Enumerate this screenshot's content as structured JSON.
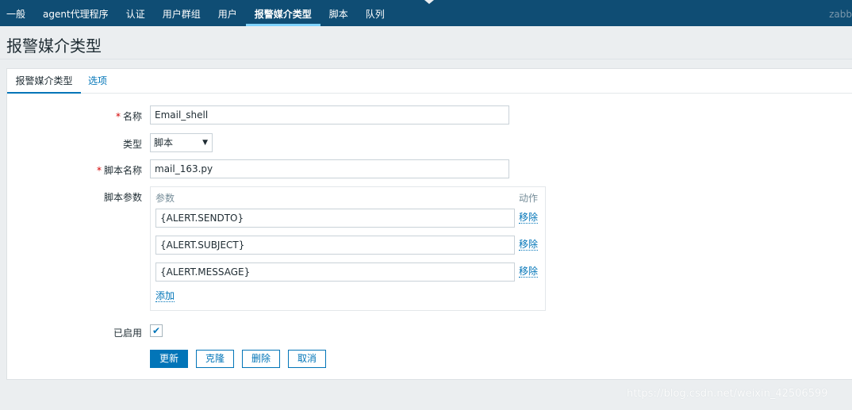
{
  "nav": {
    "items": [
      "一般",
      "agent代理程序",
      "认证",
      "用户群组",
      "用户",
      "报警媒介类型",
      "脚本",
      "队列"
    ],
    "active_index": 5,
    "brand": "zabb"
  },
  "page_title": "报警媒介类型",
  "tabs": [
    "报警媒介类型",
    "选项"
  ],
  "form": {
    "name_label": "名称",
    "name_value": "Email_shell",
    "type_label": "类型",
    "type_value": "脚本",
    "script_name_label": "脚本名称",
    "script_name_value": "mail_163.py",
    "params_label": "脚本参数",
    "params_col_header": "参数",
    "action_col_header": "动作",
    "params": [
      "{ALERT.SENDTO}",
      "{ALERT.SUBJECT}",
      "{ALERT.MESSAGE}"
    ],
    "remove_label": "移除",
    "add_label": "添加",
    "enabled_label": "已启用",
    "enabled": true
  },
  "buttons": {
    "update": "更新",
    "clone": "克隆",
    "delete": "删除",
    "cancel": "取消"
  },
  "watermark": "https://blog.csdn.net/weixin_42506599",
  "colors": {
    "nav_bg": "#0f4d74",
    "accent": "#0275b8",
    "required": "#d40000"
  }
}
